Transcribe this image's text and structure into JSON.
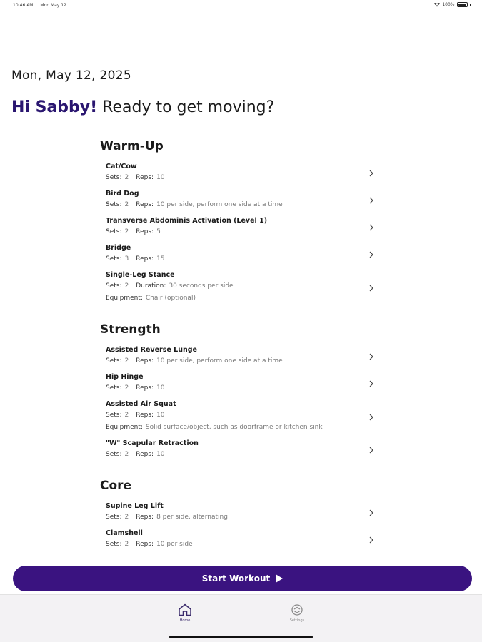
{
  "status_bar": {
    "time": "10:46 AM",
    "date": "Mon May 12",
    "battery": "100%"
  },
  "header": {
    "date": "Mon, May 12, 2025",
    "greeting_name": "Hi Sabby!",
    "greeting_rest": " Ready to get moving?"
  },
  "sections": [
    {
      "title": "Warm-Up",
      "exercises": [
        {
          "name": "Cat/Cow",
          "lines": [
            [
              {
                "k": "Sets:",
                "v": "2"
              },
              {
                "k": "Reps:",
                "v": "10"
              }
            ]
          ]
        },
        {
          "name": "Bird Dog",
          "lines": [
            [
              {
                "k": "Sets:",
                "v": "2"
              },
              {
                "k": "Reps:",
                "v": "10 per side, perform one side at a time"
              }
            ]
          ]
        },
        {
          "name": "Transverse Abdominis Activation (Level 1)",
          "lines": [
            [
              {
                "k": "Sets:",
                "v": "2"
              },
              {
                "k": "Reps:",
                "v": "5"
              }
            ]
          ]
        },
        {
          "name": "Bridge",
          "lines": [
            [
              {
                "k": "Sets:",
                "v": "3"
              },
              {
                "k": "Reps:",
                "v": "15"
              }
            ]
          ]
        },
        {
          "name": "Single-Leg Stance",
          "lines": [
            [
              {
                "k": "Sets:",
                "v": "2"
              },
              {
                "k": "Duration:",
                "v": "30 seconds per side"
              }
            ],
            [
              {
                "k": "Equipment:",
                "v": "Chair (optional)"
              }
            ]
          ]
        }
      ]
    },
    {
      "title": "Strength",
      "exercises": [
        {
          "name": "Assisted Reverse Lunge",
          "lines": [
            [
              {
                "k": "Sets:",
                "v": "2"
              },
              {
                "k": "Reps:",
                "v": "10 per side, perform one side at a time"
              }
            ]
          ]
        },
        {
          "name": "Hip Hinge",
          "lines": [
            [
              {
                "k": "Sets:",
                "v": "2"
              },
              {
                "k": "Reps:",
                "v": "10"
              }
            ]
          ]
        },
        {
          "name": "Assisted Air Squat",
          "lines": [
            [
              {
                "k": "Sets:",
                "v": "2"
              },
              {
                "k": "Reps:",
                "v": "10"
              }
            ],
            [
              {
                "k": "Equipment:",
                "v": "Solid surface/object, such as doorframe or kitchen sink"
              }
            ]
          ]
        },
        {
          "name": "\"W\" Scapular Retraction",
          "lines": [
            [
              {
                "k": "Sets:",
                "v": "2"
              },
              {
                "k": "Reps:",
                "v": "10"
              }
            ]
          ]
        }
      ]
    },
    {
      "title": "Core",
      "exercises": [
        {
          "name": "Supine Leg Lift",
          "lines": [
            [
              {
                "k": "Sets:",
                "v": "2"
              },
              {
                "k": "Reps:",
                "v": "8 per side, alternating"
              }
            ]
          ]
        },
        {
          "name": "Clamshell",
          "lines": [
            [
              {
                "k": "Sets:",
                "v": "2"
              },
              {
                "k": "Reps:",
                "v": "10 per side"
              }
            ]
          ]
        }
      ]
    }
  ],
  "start_button": {
    "label": "Start Workout"
  },
  "tabs": {
    "home": "Home",
    "settings": "Settings"
  },
  "colors": {
    "accent": "#3a1380",
    "name": "#2a1670"
  }
}
